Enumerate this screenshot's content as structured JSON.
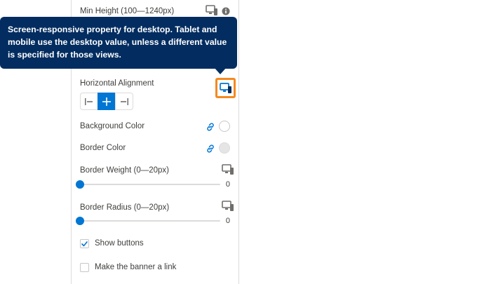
{
  "panel": {
    "min_height_label": "Min Height (100—1240px)",
    "horizontal_alignment_label": "Horizontal Alignment",
    "background_color_label": "Background Color",
    "border_color_label": "Border Color",
    "border_weight": {
      "label": "Border Weight (0—20px)",
      "value": "0",
      "fraction": 0
    },
    "border_radius": {
      "label": "Border Radius (0—20px)",
      "value": "0",
      "fraction": 0
    },
    "show_buttons": {
      "label": "Show buttons",
      "checked": true
    },
    "banner_link": {
      "label": "Make the banner a link",
      "checked": false
    }
  },
  "tooltip": {
    "text": "Screen-responsive property for desktop. Tablet and mobile use the desktop value, unless a different value is specified for those views."
  },
  "colors": {
    "tooltip_bg": "#032d60",
    "accent": "#0176d3",
    "highlight": "#f5891f",
    "border_color_swatch": "#e5e5e5",
    "background_color_swatch": "#ffffff"
  },
  "icons": [
    "desktop-icon",
    "info-icon",
    "link-icon",
    "align-left-icon",
    "align-center-icon",
    "align-right-icon",
    "checkmark-icon"
  ]
}
